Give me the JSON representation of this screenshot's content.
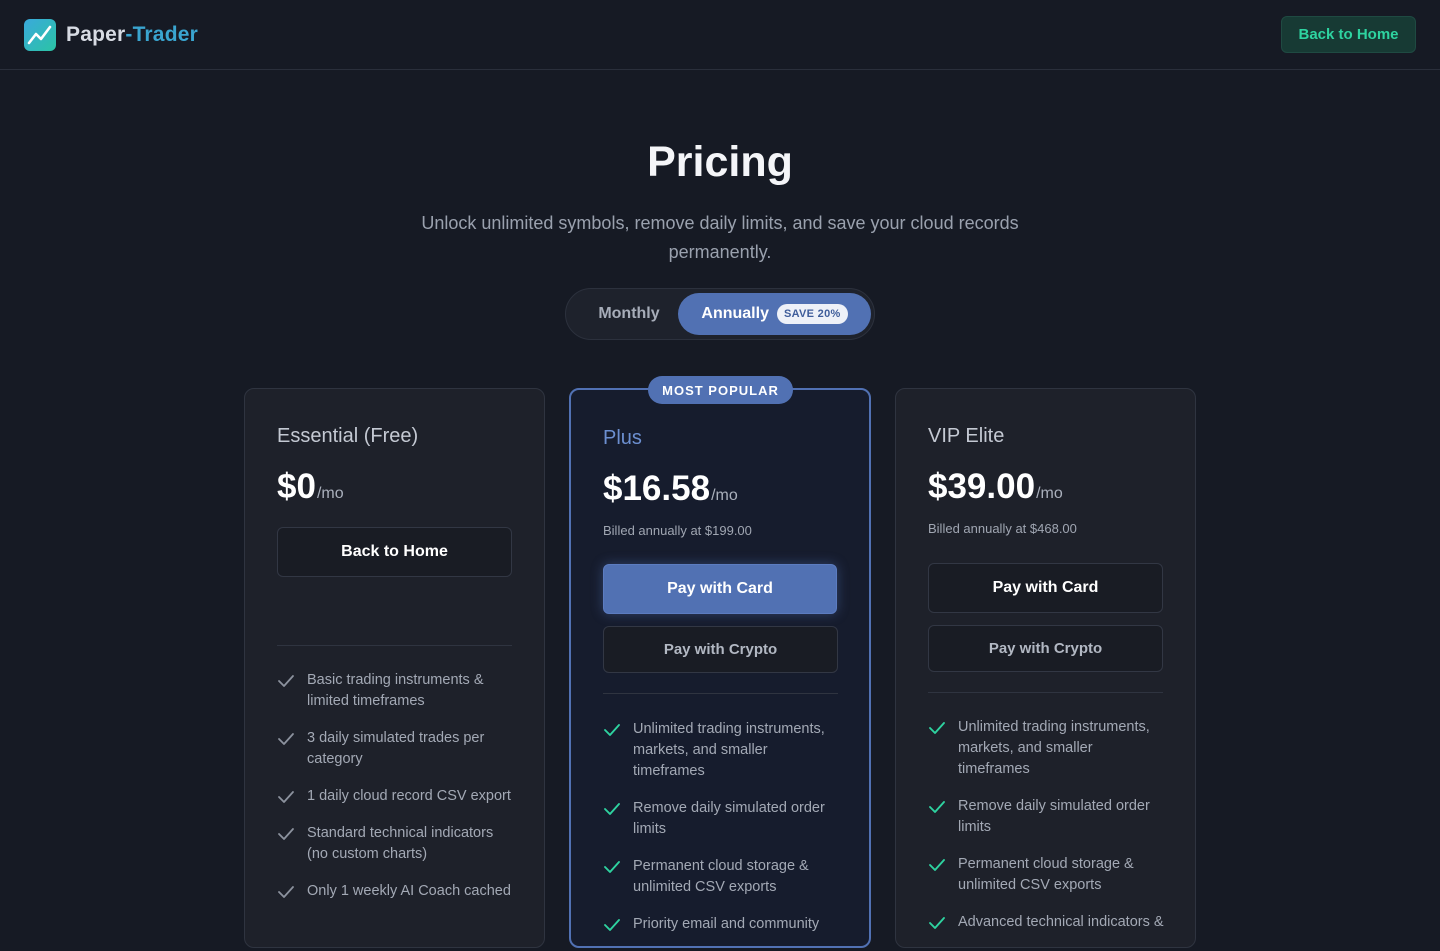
{
  "brand": {
    "part1": "Paper",
    "part2": "-Trader",
    "logo_icon": "chart-line-icon"
  },
  "header": {
    "back_label": "Back to Home"
  },
  "hero": {
    "title": "Pricing",
    "subtitle": "Unlock unlimited symbols, remove daily limits, and save your cloud records permanently."
  },
  "billing_toggle": {
    "monthly": "Monthly",
    "annually": "Annually",
    "save_badge": "SAVE 20%",
    "selected": "annually"
  },
  "colors": {
    "accent": "#5171b3",
    "success": "#2ed3a0",
    "background": "#161a24",
    "card": "#1e212a"
  },
  "plans": [
    {
      "name": "Essential (Free)",
      "price": "$0",
      "per": "/mo",
      "button": "Back to Home",
      "features": [
        "Basic trading instruments & limited timeframes",
        "3 daily simulated trades per category",
        "1 daily cloud record CSV export",
        "Standard technical indicators (no custom charts)",
        "Only 1 weekly AI Coach cached"
      ]
    },
    {
      "badge": "MOST POPULAR",
      "name": "Plus",
      "price": "$16.58",
      "per": "/mo",
      "billed": "Billed annually at $199.00",
      "card_button": "Pay with Card",
      "crypto_button": "Pay with Crypto",
      "features": [
        "Unlimited trading instruments, markets, and smaller timeframes",
        "Remove daily simulated order limits",
        "Permanent cloud storage & unlimited CSV exports",
        "Priority email and community"
      ]
    },
    {
      "name": "VIP Elite",
      "price": "$39.00",
      "per": "/mo",
      "billed": "Billed annually at $468.00",
      "card_button": "Pay with Card",
      "crypto_button": "Pay with Crypto",
      "features": [
        "Unlimited trading instruments, markets, and smaller timeframes",
        "Remove daily simulated order limits",
        "Permanent cloud storage & unlimited CSV exports",
        "Advanced technical indicators &"
      ]
    }
  ]
}
